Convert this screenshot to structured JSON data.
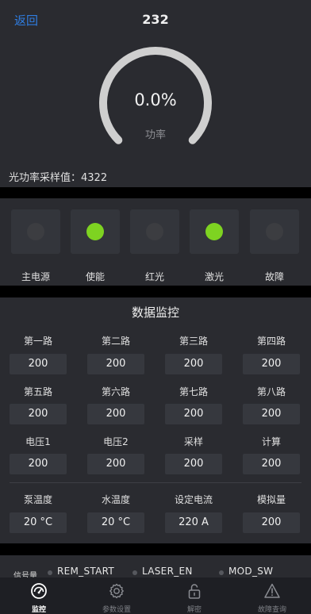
{
  "header": {
    "back_label": "返回",
    "title": "232"
  },
  "gauge": {
    "value_text": "0.0%",
    "label": "功率",
    "fraction": 0.0
  },
  "sample": {
    "text": "光功率采样值：4322"
  },
  "indicators": [
    {
      "label": "主电源",
      "on": false
    },
    {
      "label": "使能",
      "on": true
    },
    {
      "label": "红光",
      "on": false
    },
    {
      "label": "激光",
      "on": true
    },
    {
      "label": "故障",
      "on": false
    }
  ],
  "monitor": {
    "title": "数据监控",
    "rows": [
      [
        {
          "label": "第一路",
          "value": "200"
        },
        {
          "label": "第二路",
          "value": "200"
        },
        {
          "label": "第三路",
          "value": "200"
        },
        {
          "label": "第四路",
          "value": "200"
        }
      ],
      [
        {
          "label": "第五路",
          "value": "200"
        },
        {
          "label": "第六路",
          "value": "200"
        },
        {
          "label": "第七路",
          "value": "200"
        },
        {
          "label": "第八路",
          "value": "200"
        }
      ],
      [
        {
          "label": "电压1",
          "value": "200"
        },
        {
          "label": "电压2",
          "value": "200"
        },
        {
          "label": "采样",
          "value": "200"
        },
        {
          "label": "计算",
          "value": "200"
        }
      ],
      [
        {
          "label": "泵温度",
          "value": "20 °C"
        },
        {
          "label": "水温度",
          "value": "20 °C"
        },
        {
          "label": "设定电流",
          "value": "220 A"
        },
        {
          "label": "模拟量",
          "value": "200"
        }
      ]
    ]
  },
  "signals": {
    "title": "信号量",
    "items": [
      "REM_START",
      "LASER_EN",
      "MOD_SW"
    ]
  },
  "nav": {
    "items": [
      {
        "label": "监控",
        "icon": "gauge-icon",
        "active": true
      },
      {
        "label": "参数设置",
        "icon": "gear-icon",
        "active": false
      },
      {
        "label": "解密",
        "icon": "unlock-icon",
        "active": false
      },
      {
        "label": "故障查询",
        "icon": "warning-icon",
        "active": false
      }
    ]
  },
  "colors": {
    "accent": "#2f7de1",
    "indicator_on": "#7ed321",
    "panel": "#2a2b30"
  }
}
